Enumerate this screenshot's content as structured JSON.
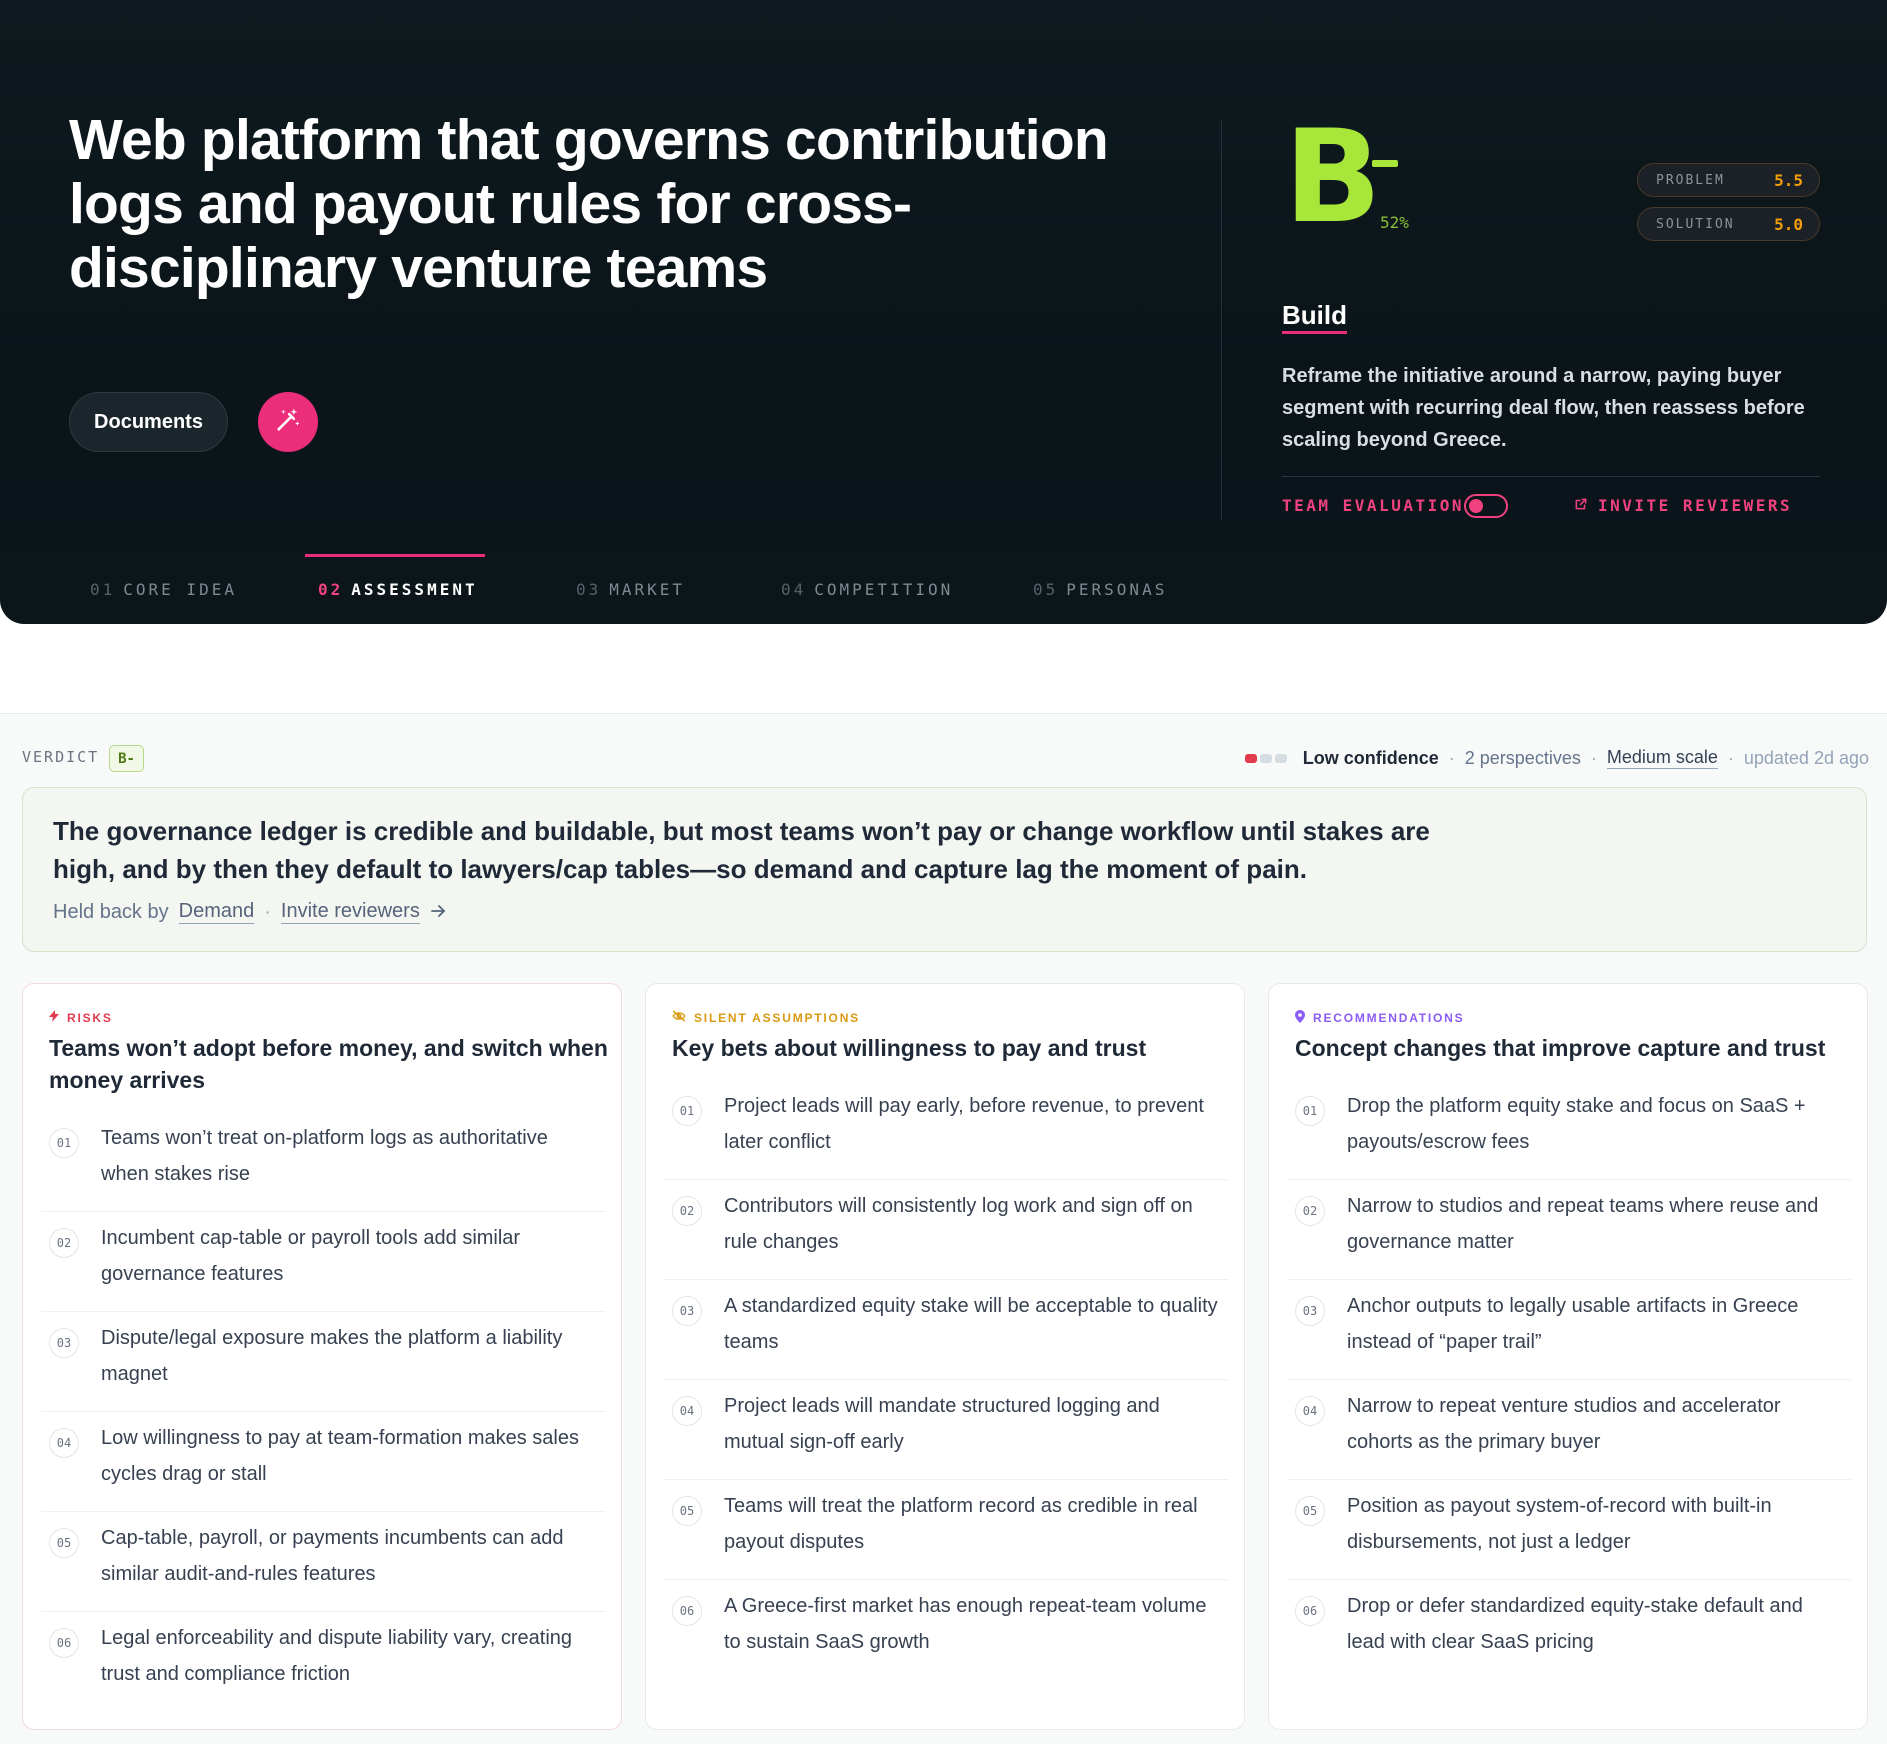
{
  "hero": {
    "title": "Web platform that governs contribution logs and payout rules for cross-disciplinary venture teams",
    "documents_label": "Documents",
    "magic_icon": "magic-wand-icon",
    "grade": "B",
    "grade_suffix": "-",
    "grade_percent": "52%",
    "scores": [
      {
        "label": "PROBLEM",
        "value": "5.5"
      },
      {
        "label": "SOLUTION",
        "value": "5.0"
      }
    ],
    "build_title": "Build",
    "build_description": "Reframe the initiative around a narrow, paying buyer segment with recurring deal flow, then reassess before scaling beyond Greece.",
    "team_evaluation_label": "TEAM EVALUATION",
    "team_evaluation_on": false,
    "invite_reviewers_label": "INVITE REVIEWERS",
    "tabs": [
      {
        "num": "01",
        "label": "CORE IDEA",
        "active": false
      },
      {
        "num": "02",
        "label": "ASSESSMENT",
        "active": true
      },
      {
        "num": "03",
        "label": "MARKET",
        "active": false
      },
      {
        "num": "04",
        "label": "COMPETITION",
        "active": false
      },
      {
        "num": "05",
        "label": "PERSONAS",
        "active": false
      }
    ]
  },
  "verdict": {
    "label": "VERDICT",
    "badge": "B-",
    "confidence": "Low confidence",
    "perspectives": "2 perspectives",
    "scale": "Medium scale",
    "updated": "updated 2d ago",
    "summary": "The governance ledger is credible and buildable, but most teams won’t pay or change workflow until stakes are high, and by then they default to lawyers/cap tables—so demand and capture lag the moment of pain.",
    "held_back_prefix": "Held back by",
    "held_back_by": "Demand",
    "invite_link": "Invite reviewers",
    "separator": "·"
  },
  "columns": {
    "risks": {
      "kicker": "RISKS",
      "title": "Teams won’t adopt before money, and switch when money arrives",
      "items": [
        "Teams won’t treat on-platform logs as authoritative when stakes rise",
        "Incumbent cap-table or payroll tools add similar governance features",
        "Dispute/legal exposure makes the platform a liability magnet",
        "Low willingness to pay at team-formation makes sales cycles drag or stall",
        "Cap-table, payroll, or payments incumbents can add similar audit-and-rules features",
        "Legal enforceability and dispute liability vary, creating trust and compliance friction"
      ]
    },
    "assumptions": {
      "kicker": "SILENT ASSUMPTIONS",
      "title": "Key bets about willingness to pay and trust",
      "items": [
        "Project leads will pay early, before revenue, to prevent later conflict",
        "Contributors will consistently log work and sign off on rule changes",
        "A standardized equity stake will be acceptable to quality teams",
        "Project leads will mandate structured logging and mutual sign-off early",
        "Teams will treat the platform record as credible in real payout disputes",
        "A Greece-first market has enough repeat-team volume to sustain SaaS growth"
      ]
    },
    "recommendations": {
      "kicker": "RECOMMENDATIONS",
      "title": "Concept changes that improve capture and trust",
      "items": [
        "Drop the platform equity stake and focus on SaaS + payouts/escrow fees",
        "Narrow to studios and repeat teams where reuse and governance matter",
        "Anchor outputs to legally usable artifacts in Greece instead of “paper trail”",
        "Narrow to repeat venture studios and accelerator cohorts as the primary buyer",
        "Position as payout system-of-record with built-in disbursements, not just a ledger",
        "Drop or defer standardized equity-stake default and lead with clear SaaS pricing"
      ]
    }
  },
  "item_numbers": [
    "01",
    "02",
    "03",
    "04",
    "05",
    "06"
  ],
  "colors": {
    "accent_pink": "#ec2d7a",
    "grade_green": "#a8e63a",
    "score_orange": "#f59e0b",
    "risk_red": "#e23b4e",
    "assumption_amber": "#d99a12",
    "recommendation_purple": "#8b5cf6"
  }
}
